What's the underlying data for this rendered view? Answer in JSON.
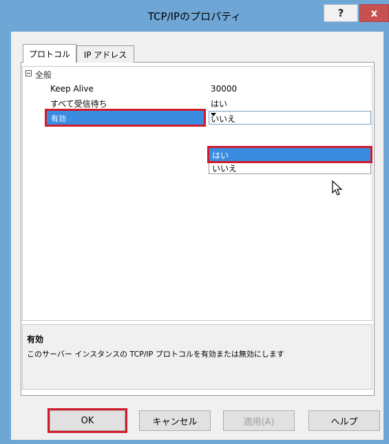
{
  "window": {
    "title": "TCP/IPのプロパティ",
    "help_label": "?",
    "close_label": "x"
  },
  "tabs": [
    {
      "label": "プロトコル"
    },
    {
      "label": "IP アドレス"
    }
  ],
  "grid": {
    "category": "全般",
    "properties": [
      {
        "name": "Keep Alive",
        "value": "30000"
      },
      {
        "name": "すべて受信待ち",
        "value": "はい"
      },
      {
        "name": "有効",
        "value": "いいえ"
      }
    ],
    "dropdown_options": [
      "はい",
      "いいえ"
    ]
  },
  "description": {
    "title": "有効",
    "text": "このサーバー インスタンスの TCP/IP プロトコルを有効または無効にします"
  },
  "buttons": {
    "ok": "OK",
    "cancel": "キャンセル",
    "apply": "適用(A)",
    "help": "ヘルプ"
  }
}
